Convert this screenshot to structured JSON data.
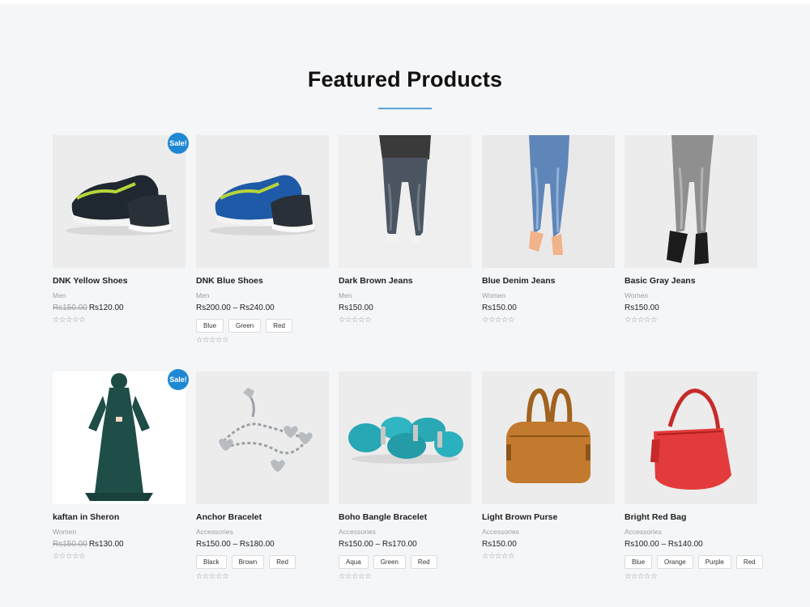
{
  "page": {
    "title": "Featured Products"
  },
  "products": [
    {
      "name": "DNK Yellow Shoes",
      "category": "Men",
      "old_price": "Rs150.00",
      "price": "Rs120.00",
      "sale": "Sale!",
      "stars": "☆☆☆☆☆"
    },
    {
      "name": "DNK Blue Shoes",
      "category": "Men",
      "price": "Rs200.00 – Rs240.00",
      "swatches": [
        "Blue",
        "Green",
        "Red"
      ],
      "stars": "☆☆☆☆☆"
    },
    {
      "name": "Dark Brown Jeans",
      "category": "Men",
      "price": "Rs150.00",
      "stars": "☆☆☆☆☆"
    },
    {
      "name": "Blue Denim Jeans",
      "category": "Women",
      "price": "Rs150.00",
      "stars": "☆☆☆☆☆"
    },
    {
      "name": "Basic Gray Jeans",
      "category": "Women",
      "price": "Rs150.00",
      "stars": "☆☆☆☆☆"
    },
    {
      "name": "kaftan in Sheron",
      "category": "Women",
      "old_price": "Rs150.00",
      "price": "Rs130.00",
      "sale": "Sale!",
      "stars": "☆☆☆☆☆"
    },
    {
      "name": "Anchor Bracelet",
      "category": "Accessories",
      "price": "Rs150.00 – Rs180.00",
      "swatches": [
        "Black",
        "Brown",
        "Red"
      ],
      "stars": "☆☆☆☆☆"
    },
    {
      "name": "Boho Bangle Bracelet",
      "category": "Accessories",
      "price": "Rs150.00 – Rs170.00",
      "swatches": [
        "Aqua",
        "Green",
        "Red"
      ],
      "stars": "☆☆☆☆☆"
    },
    {
      "name": "Light Brown Purse",
      "category": "Accessories",
      "price": "Rs150.00",
      "stars": "☆☆☆☆☆"
    },
    {
      "name": "Bright Red Bag",
      "category": "Accessories",
      "price": "Rs100.00 – Rs140.00",
      "swatches": [
        "Blue",
        "Orange",
        "Purple",
        "Red"
      ],
      "stars": "☆☆☆☆☆"
    }
  ]
}
